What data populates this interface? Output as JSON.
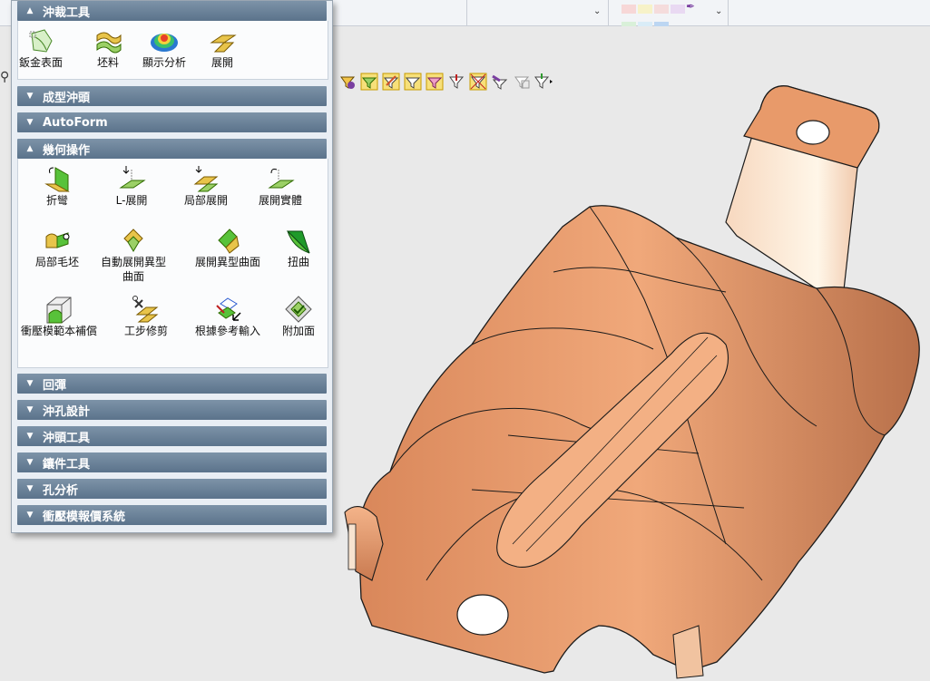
{
  "panel": {
    "sections": [
      {
        "label": "沖裁工具",
        "expanded": true
      },
      {
        "label": "成型沖頭",
        "expanded": false
      },
      {
        "label": "AutoForm",
        "expanded": false
      },
      {
        "label": "幾何操作",
        "expanded": true
      },
      {
        "label": "回彈",
        "expanded": false
      },
      {
        "label": "沖孔設計",
        "expanded": false
      },
      {
        "label": "沖頭工具",
        "expanded": false
      },
      {
        "label": "鑲件工具",
        "expanded": false
      },
      {
        "label": "孔分析",
        "expanded": false
      },
      {
        "label": "衝壓模報價系統",
        "expanded": false
      }
    ],
    "blanking_tools": [
      {
        "label": "鈑金表面",
        "icon": "sheet-surface-icon"
      },
      {
        "label": "坯料",
        "icon": "blank-icon"
      },
      {
        "label": "顯示分析",
        "icon": "display-analysis-icon"
      },
      {
        "label": "展開",
        "icon": "unfold-icon"
      }
    ],
    "geometry_tools": [
      {
        "label": "折彎",
        "icon": "bend-icon"
      },
      {
        "label": "L-展開",
        "icon": "l-unfold-icon"
      },
      {
        "label": "局部展開",
        "icon": "partial-unfold-icon"
      },
      {
        "label": "展開實體",
        "icon": "unfold-solid-icon"
      },
      {
        "label": "局部毛坯",
        "icon": "partial-blank-icon"
      },
      {
        "label": "自動展開異型曲面",
        "icon": "auto-unfold-surface-icon"
      },
      {
        "label": "展開異型曲面",
        "icon": "unfold-surface-icon"
      },
      {
        "label": "扭曲",
        "icon": "twist-icon"
      },
      {
        "label": "衝壓模範本補償",
        "icon": "die-compensation-icon"
      },
      {
        "label": "工步修剪",
        "icon": "step-trim-icon"
      },
      {
        "label": "根據參考輸入",
        "icon": "reference-input-icon"
      },
      {
        "label": "附加面",
        "icon": "add-face-icon"
      }
    ]
  },
  "colors": {
    "part_fill": "#e8996a",
    "part_edge": "#1a1a1a",
    "section_header": "#6a8298",
    "icon_green": "#58c23a",
    "icon_yellow": "#e8c44a"
  }
}
